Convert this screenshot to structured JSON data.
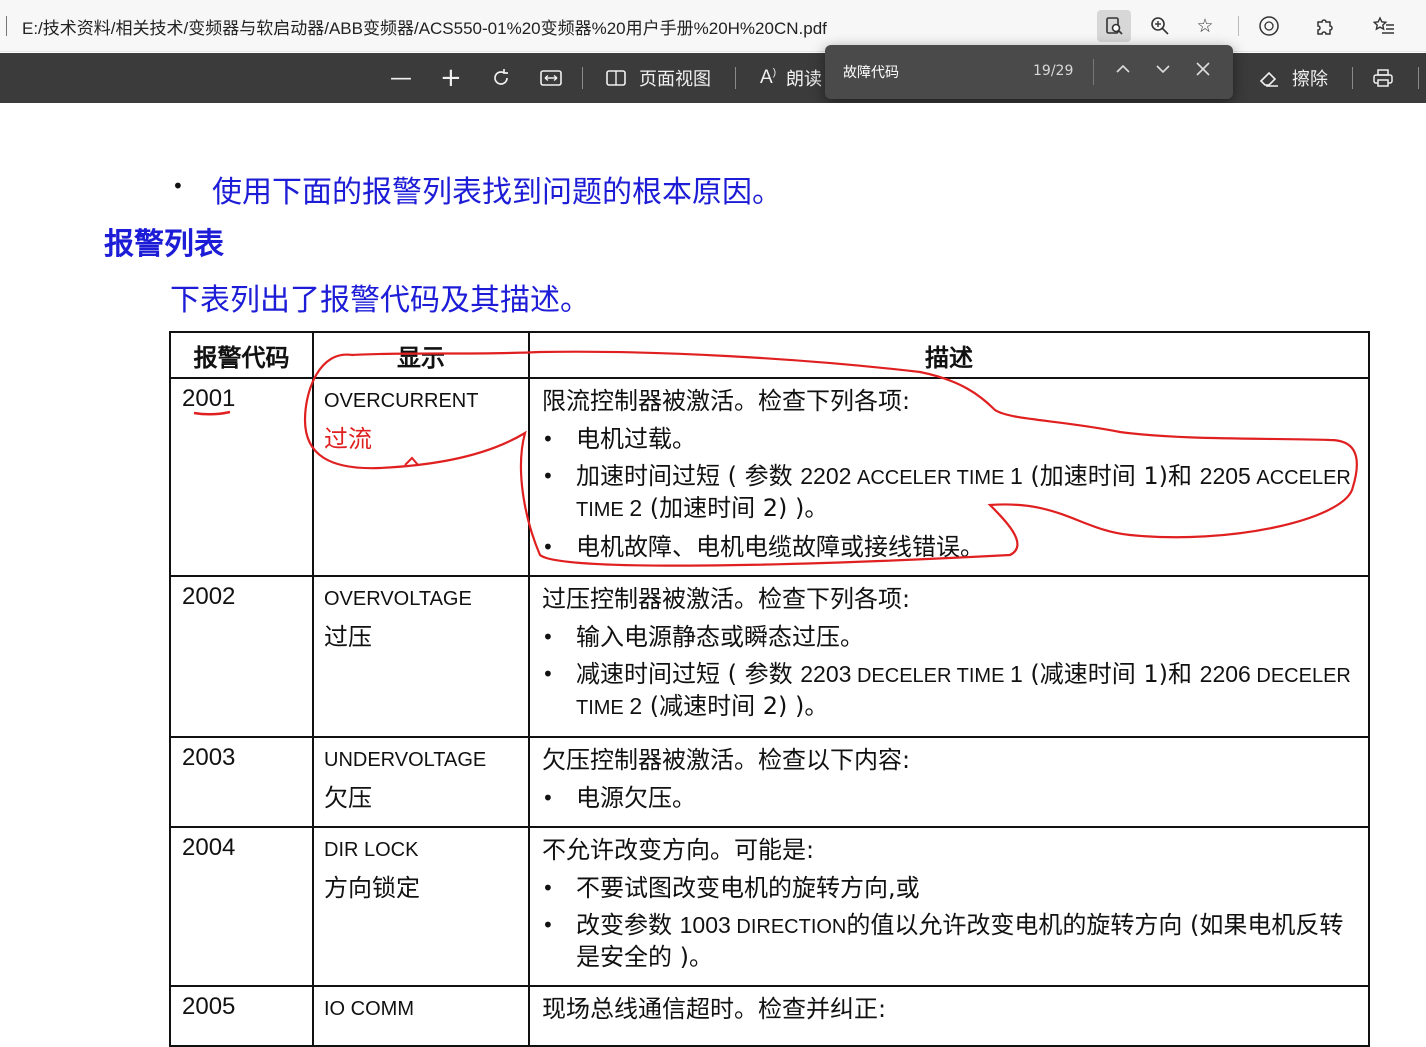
{
  "browser": {
    "address": "E:/技术资料/相关技术/变频器与软启动器/ABB变频器/ACS550-01%20变频器%20用户手册%20H%20CN.pdf",
    "icons": [
      "read-aloud-doc-icon",
      "zoom-icon",
      "favorite-add-icon",
      "extensions-icon",
      "puzzle-icon",
      "favorites-icon"
    ]
  },
  "pdf_toolbar": {
    "zoom_out": "—",
    "zoom_in": "+",
    "page_view_label": "页面视图",
    "read_label": "朗读",
    "erase_label": "擦除"
  },
  "find": {
    "query": "故障代码",
    "count": "19/29"
  },
  "doc": {
    "bullet_text": "使用下面的报警列表找到问题的根本原因。",
    "heading": "报警列表",
    "intro": "下表列出了报警代码及其描述。",
    "table": {
      "headers": [
        "报警代码",
        "显示",
        "描述"
      ],
      "rows": [
        {
          "code": "2001",
          "display_en": "OVERCURRENT",
          "display_zh": "过流",
          "desc_lead": "限流控制器被激活。检查下列各项:",
          "items": [
            [
              "电机过载。"
            ],
            [
              "加速时间过短 ( 参数 ",
              "2202",
              " ACCELER TIME ",
              "1",
              " (加速时间 1)和 ",
              "2205",
              " ACCELER TIME ",
              "2",
              " (加速时间 2) )。"
            ],
            [
              "电机故障、电机电缆故障或接线错误。"
            ]
          ]
        },
        {
          "code": "2002",
          "display_en": "OVERVOLTAGE",
          "display_zh": "过压",
          "desc_lead": "过压控制器被激活。检查下列各项:",
          "items": [
            [
              "输入电源静态或瞬态过压。"
            ],
            [
              "减速时间过短 ( 参数 ",
              "2203",
              " DECELER TIME ",
              "1",
              " (减速时间 1)和 ",
              "2206",
              " DECELER TIME ",
              "2",
              " (减速时间 2) )。"
            ]
          ]
        },
        {
          "code": "2003",
          "display_en": "UNDERVOLTAGE",
          "display_zh": "欠压",
          "desc_lead": "欠压控制器被激活。检查以下内容:",
          "items": [
            [
              "电源欠压。"
            ]
          ]
        },
        {
          "code": "2004",
          "display_en": "DIR LOCK",
          "display_zh": "方向锁定",
          "desc_lead": "不允许改变方向。可能是:",
          "items": [
            [
              "不要试图改变电机的旋转方向,或"
            ],
            [
              "改变参数 ",
              "1003",
              " DIRECTION",
              "的值以允许改变电机的旋转方向 (如果电机反转是安全的 )。"
            ]
          ]
        },
        {
          "code": "2005",
          "display_en": "IO COMM",
          "display_zh": "",
          "desc_lead": "现场总线通信超时。检查并纠正:",
          "items": []
        }
      ]
    }
  },
  "colors": {
    "doc_blue": "#1d1cd6",
    "annotation_red": "#e02020",
    "pdf_toolbar_bg": "#3b3b3b"
  }
}
